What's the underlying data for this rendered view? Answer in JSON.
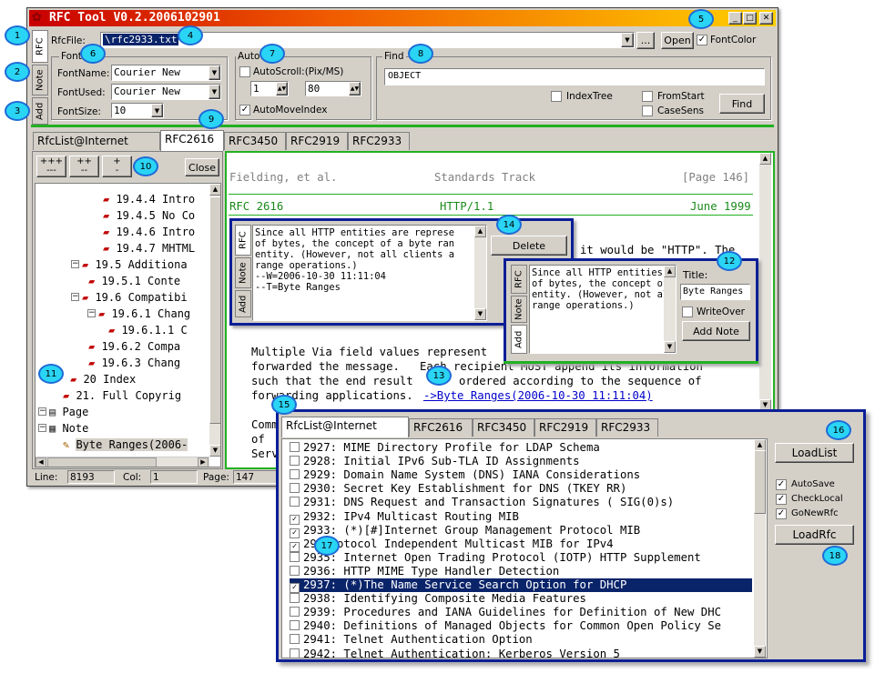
{
  "window": {
    "title": "RFC Tool V0.2.2006102901"
  },
  "side_tabs": [
    "RFC",
    "Note",
    "Add"
  ],
  "toolbar": {
    "rfcfile_label": "RfcFile:",
    "rfcfile_value": "\\rfc2933.txt",
    "browse_label": "...",
    "open_label": "Open",
    "fontcolor_label": "FontColor"
  },
  "font": {
    "group": "Font",
    "name_label": "FontName:",
    "name_value": "Courier New",
    "used_label": "FontUsed:",
    "used_value": "Courier New",
    "size_label": "FontSize:",
    "size_value": "10"
  },
  "auto": {
    "group": "Auto",
    "autoscroll_label": "AutoScroll:(Pix/MS)",
    "scroll_a": "1",
    "scroll_b": "80",
    "automove_label": "AutoMoveIndex"
  },
  "find": {
    "group": "Find",
    "input_value": "OBJECT",
    "indextree_label": "IndexTree",
    "fromstart_label": "FromStart",
    "casesens_label": "CaseSens",
    "find_label": "Find"
  },
  "tabs": [
    "RfcList@Internet",
    "RFC2616",
    "RFC3450",
    "RFC2919",
    "RFC2933"
  ],
  "tree": {
    "btn_expand_all": "+++",
    "btn_collapse_all": "---",
    "btn_expand": "++",
    "btn_collapse": "--",
    "btn_plus": "+",
    "btn_minus": "-",
    "close_label": "Close",
    "items": [
      {
        "text": "19.4.4 Intro"
      },
      {
        "text": "19.4.5 No Co"
      },
      {
        "text": "19.4.6 Intro"
      },
      {
        "text": "19.4.7 MHTML"
      },
      {
        "text": "19.5 Additiona"
      },
      {
        "text": "19.5.1 Conte"
      },
      {
        "text": "19.6 Compatibi"
      },
      {
        "text": "19.6.1 Chang"
      },
      {
        "text": "19.6.1.1 C"
      },
      {
        "text": "19.6.2 Compa"
      },
      {
        "text": "19.6.3 Chang"
      },
      {
        "text": "20 Index"
      },
      {
        "text": "21.  Full Copyrig"
      },
      {
        "text": "Page"
      },
      {
        "text": "Note"
      },
      {
        "text": "Byte Ranges(2006-"
      }
    ]
  },
  "doc": {
    "footer_left": "Fielding, et al.",
    "footer_mid": "Standards Track",
    "footer_right": "[Page 146]",
    "header_left": "RFC 2616",
    "header_mid": "HTTP/1.1",
    "header_right": "June 1999",
    "line_http": "it would be \"HTTP\". The",
    "para1": "Multiple Via field values represent",
    "para2": "forwarded the message.",
    "para2b": "Each recipient MUST append its information",
    "para3": "such that the end result",
    "para3b": "ordered according to the sequence of",
    "para4": "forwarding applications.",
    "link": "->Byte Ranges(2006-10-30 11:11:04)",
    "frag1": "Comm",
    "frag2": "of",
    "frag3": "Serv"
  },
  "note_popup": {
    "text": "Since all HTTP entities are represe\nof bytes, the concept of a byte ran\nentity. (However, not all clients a\nrange operations.)\n--W=2006-10-30 11:11:04\n--T=Byte Ranges",
    "delete_label": "Delete"
  },
  "add_popup": {
    "text": "Since all HTTP entities\nof bytes, the concept of\nentity. (However, not al\nrange operations.)",
    "title_label": "Title:",
    "title_value": "Byte Ranges",
    "writeover_label": "WriteOver",
    "addnote_label": "Add Note"
  },
  "status": {
    "line_label": "Line:",
    "line_value": "8193",
    "col_label": "Col:",
    "col_value": "1",
    "page_label": "Page:",
    "page_value": "147"
  },
  "rfclist": {
    "items": [
      {
        "text": "2927: MIME Directory Profile for LDAP Schema",
        "checked": false
      },
      {
        "text": "2928: Initial IPv6 Sub-TLA ID Assignments",
        "checked": false
      },
      {
        "text": "2929: Domain Name System (DNS) IANA Considerations",
        "checked": false
      },
      {
        "text": "2930: Secret Key Establishment for DNS (TKEY RR)",
        "checked": false
      },
      {
        "text": "2931: DNS Request and Transaction Signatures ( SIG(0)s)",
        "checked": false
      },
      {
        "text": "2932: IPv4 Multicast Routing MIB",
        "checked": true
      },
      {
        "text": "2933: (*)[#]Internet Group Management Protocol MIB",
        "checked": true
      },
      {
        "text": "29    Protocol Independent Multicast MIB for IPv4",
        "checked": true
      },
      {
        "text": "2935: Internet Open Trading Protocol (IOTP) HTTP Supplement",
        "checked": false
      },
      {
        "text": "2936: HTTP MIME Type Handler Detection",
        "checked": false
      },
      {
        "text": "2937: (*)The Name Service Search Option for DHCP",
        "checked": true,
        "selected": true
      },
      {
        "text": "2938: Identifying Composite Media Features",
        "checked": false
      },
      {
        "text": "2939: Procedures and IANA Guidelines for Definition of New DHC",
        "checked": false
      },
      {
        "text": "2940: Definitions of Managed Objects for Common Open Policy Se",
        "checked": false
      },
      {
        "text": "2941: Telnet Authentication Option",
        "checked": false
      },
      {
        "text": "2942: Telnet Authentication: Kerberos Version 5",
        "checked": false
      }
    ],
    "loadlist_label": "LoadList",
    "autosave_label": "AutoSave",
    "checklocal_label": "CheckLocal",
    "gonewrfc_label": "GoNewRfc",
    "loadrfc_label": "LoadRfc"
  },
  "badges": [
    "1",
    "2",
    "3",
    "4",
    "5",
    "6",
    "7",
    "8",
    "9",
    "10",
    "11",
    "12",
    "13",
    "14",
    "15",
    "16",
    "17",
    "18"
  ],
  "colors": {
    "titlebar_start": "#c80000",
    "titlebar_end": "#ffd000",
    "accent_green": "#22b022",
    "highlight_blue": "#0a1e96",
    "callout": "#2ad4f4"
  }
}
